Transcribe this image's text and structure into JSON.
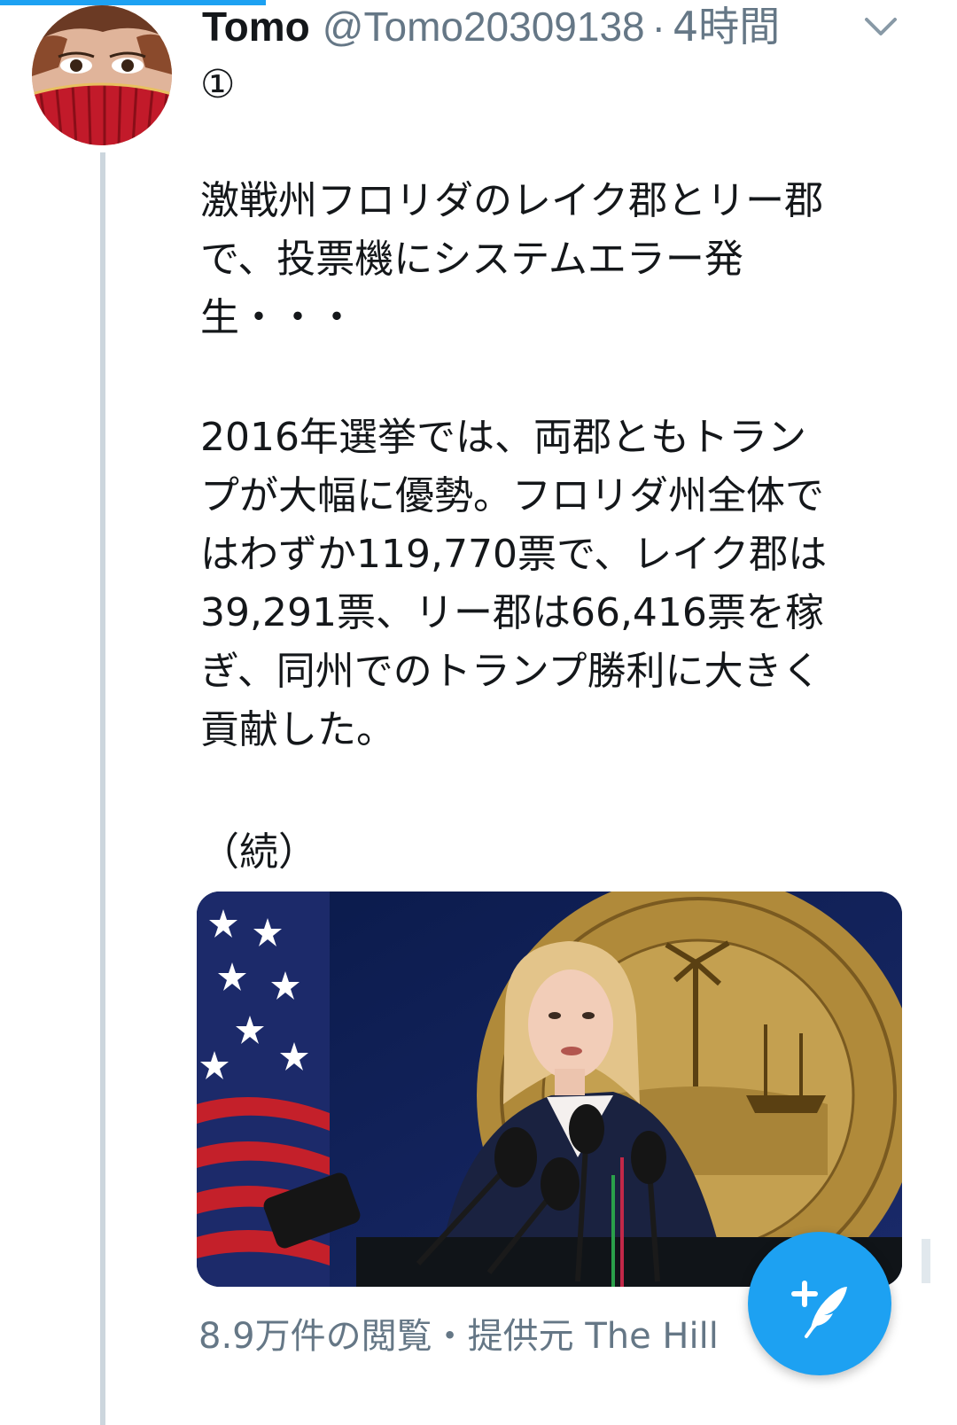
{
  "tweet": {
    "display_name": "Tomo",
    "handle": "@Tomo20309138",
    "separator": "·",
    "time": "4時間",
    "thread_number": "①",
    "text_paragraph_1": "激戦州フロリダのレイク郡とリー郡\nで、投票機にシステムエラー発\n生・・・",
    "text_paragraph_2": "2016年選挙では、両郡ともトラン\nプが大幅に優勢。フロリダ州全体で\nはわずか119,770票で、レイク郡は\n39,291票、リー郡は66,416票を稼\nぎ、同州でのトランプ勝利に大きく\n貢献した。",
    "text_paragraph_3": "（続）",
    "views_and_source": "8.9万件の閲覧・提供元 The Hill"
  },
  "icons": {
    "menu": "chevron-down-icon",
    "compose": "compose-tweet-icon"
  },
  "colors": {
    "accent": "#1da1f2",
    "secondary_text": "#657786",
    "thread_line": "#ccd6dd"
  }
}
